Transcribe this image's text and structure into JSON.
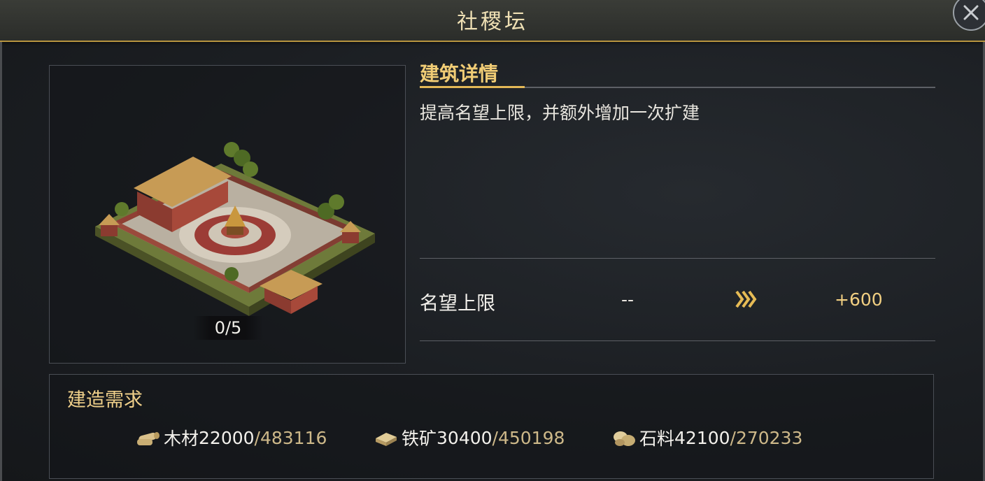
{
  "window": {
    "title": "社稷坛",
    "close_icon": "close-icon"
  },
  "building": {
    "level": "0/5",
    "art_icon": "building-illustration"
  },
  "details": {
    "heading": "建筑详情",
    "description": "提高名望上限，并额外增加一次扩建",
    "stat": {
      "name": "名望上限",
      "current": "--",
      "next": "+600",
      "arrow_icon": "triple-chevron-right-icon"
    }
  },
  "requirements": {
    "heading": "建造需求",
    "items": [
      {
        "icon": "wood-icon",
        "name": "木材",
        "cost": "22000",
        "have": "/483116"
      },
      {
        "icon": "iron-ore-icon",
        "name": "铁矿",
        "cost": "30400",
        "have": "/450198"
      },
      {
        "icon": "stone-icon",
        "name": "石料",
        "cost": "42100",
        "have": "/270233"
      }
    ]
  },
  "colors": {
    "accent_gold": "#e3b857",
    "text_gold": "#f0cc75",
    "panel_border": "#4a4e55"
  }
}
